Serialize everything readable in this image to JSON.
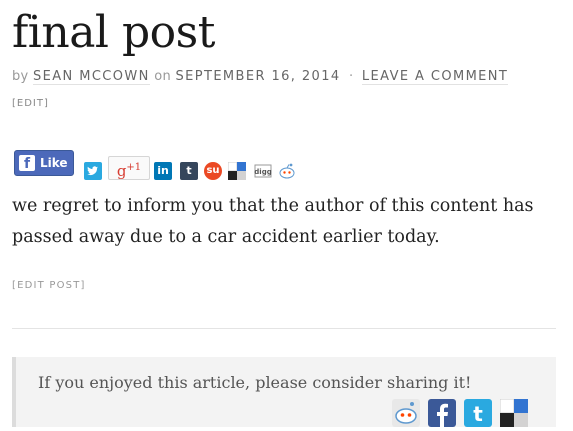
{
  "post": {
    "title": "final post",
    "meta": {
      "by": "by",
      "author": "SEAN MCCOWN",
      "on": "on",
      "date": "SEPTEMBER 16, 2014",
      "separator": "·",
      "comment_link": "LEAVE A COMMENT"
    },
    "edit_label": "[EDIT]",
    "body": "we regret to inform you that the author of this content has passed away due to a car accident earlier today.",
    "edit_post_label": "[EDIT POST]"
  },
  "share_bar": {
    "fb_like_label": "Like",
    "gplus_label": "g",
    "gplus_count": "+1",
    "icons": [
      "twitter-icon",
      "google-plus-icon",
      "linkedin-icon",
      "tumblr-icon",
      "stumbleupon-icon",
      "delicious-icon",
      "digg-icon",
      "reddit-icon"
    ]
  },
  "share_box": {
    "text": "If you enjoyed this article, please consider sharing it!",
    "icons": [
      "reddit-icon",
      "facebook-icon",
      "twitter-icon",
      "delicious-icon"
    ]
  },
  "colors": {
    "facebook": "#4c69ba",
    "twitter": "#2aa9e0",
    "linkedin": "#0077b5",
    "tumblr": "#35465c",
    "stumbleupon": "#eb4924",
    "google_plus": "#d73d32"
  }
}
